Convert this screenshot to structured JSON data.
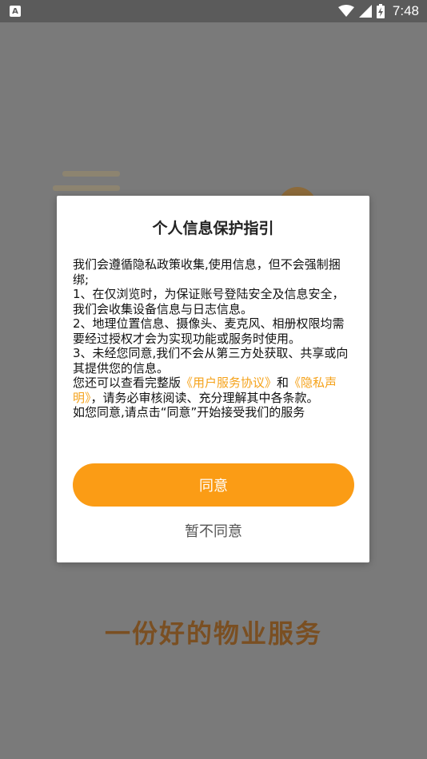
{
  "status_bar": {
    "notification_icon_letter": "A",
    "time": "7:48",
    "icons": [
      "notification-app-icon",
      "wifi-icon",
      "cell-signal-icon",
      "battery-charging-icon"
    ]
  },
  "splash": {
    "slogan": "一份好的物业服务"
  },
  "dialog": {
    "title": "个人信息保护指引",
    "para1": "我们会遵循隐私政策收集,使用信息，但不会强制捆绑;",
    "para2": " 1、在仅浏览时，为保证账号登陆安全及信息安全，我们会收集设备信息与日志信息。",
    "para3": " 2、地理位置信息、摄像头、麦克风、相册权限均需要经过授权才会为实现功能或服务时使用。",
    "para4": " 3、未经您同意,我们不会从第三方处获取、共享或向其提供您的信息。",
    "para5_prefix": " 您还可以查看完整版",
    "user_agreement_link": "《用户服务协议》",
    "para5_and": "和",
    "privacy_link": "《隐私声明》",
    "para5_suffix": "，请务必审核阅读、充分理解其中各条款。",
    "para6": " 如您同意,请点击“同意”开始接受我们的服务",
    "agree_label": "同意",
    "disagree_label": "暂不同意"
  },
  "colors": {
    "accent": "#fb9c15",
    "link": "#f5a21a",
    "overlay": "#7a7a7a"
  }
}
